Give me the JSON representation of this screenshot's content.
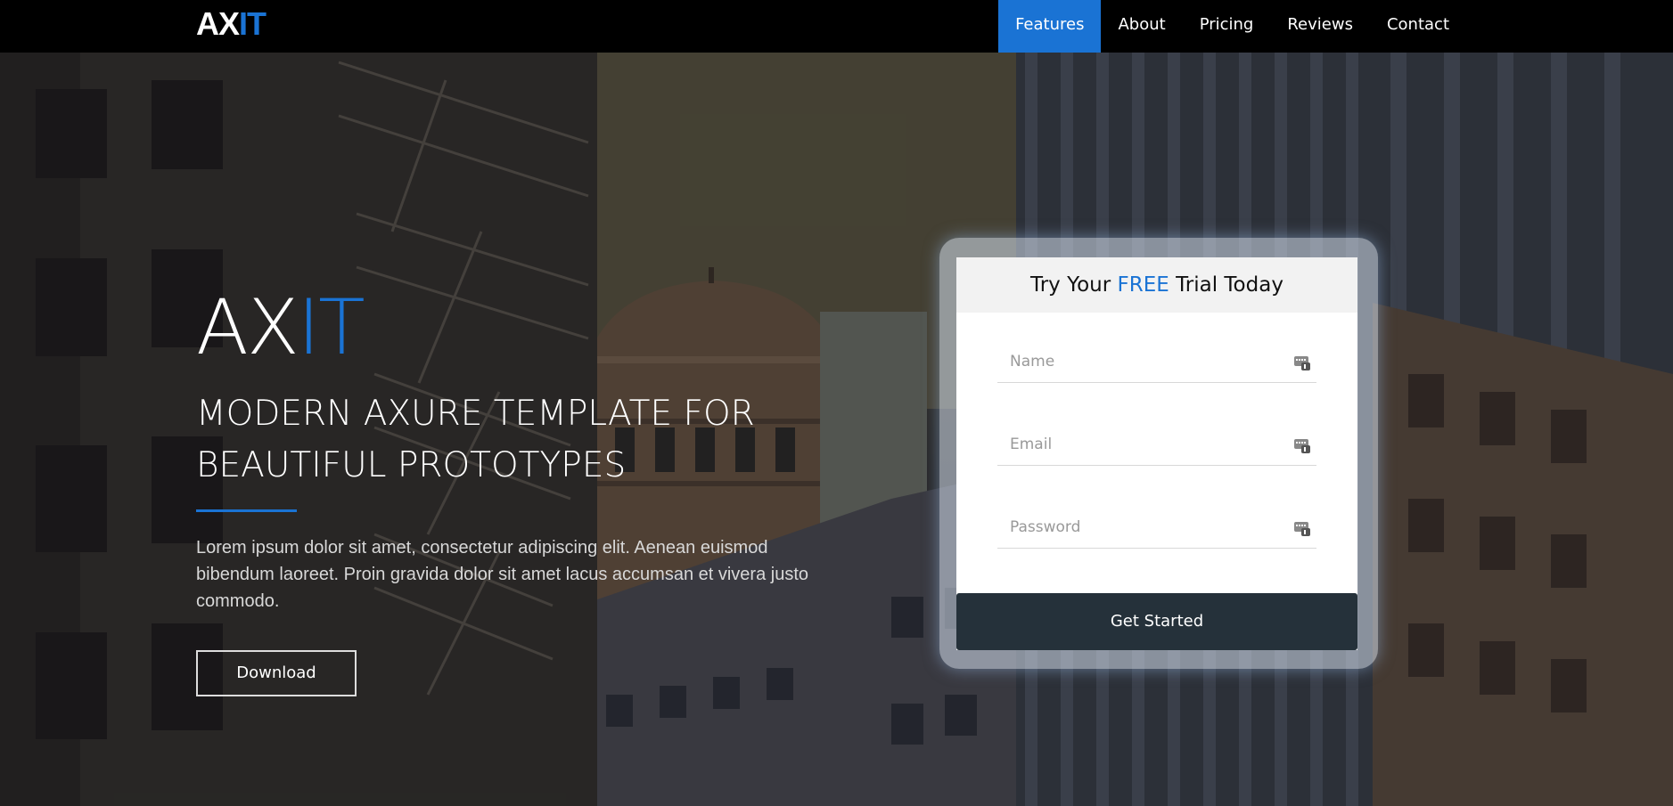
{
  "navbar": {
    "brand": {
      "main": "AX",
      "accent": "IT"
    },
    "items": [
      {
        "label": "Features",
        "active": true
      },
      {
        "label": "About",
        "active": false
      },
      {
        "label": "Pricing",
        "active": false
      },
      {
        "label": "Reviews",
        "active": false
      },
      {
        "label": "Contact",
        "active": false
      }
    ]
  },
  "hero": {
    "logo": {
      "main": "AX",
      "accent": "IT"
    },
    "title_line1": "MODERN AXURE TEMPLATE FOR",
    "title_line2": "BEAUTIFUL PROTOTYPES",
    "description": "Lorem ipsum dolor sit amet, consectetur adipiscing elit. Aenean euismod bibendum laoreet. Proin gravida dolor sit amet lacus accumsan et vivera justo commodo.",
    "download_label": "Download"
  },
  "form": {
    "title_prefix": "Try Your ",
    "title_highlight": "FREE",
    "title_suffix": " Trial Today",
    "name_placeholder": "Name",
    "email_placeholder": "Email",
    "password_placeholder": "Password",
    "submit_label": "Get Started",
    "field_icon": "autofill-key-icon"
  },
  "colors": {
    "accent": "#1a73d4",
    "navbar_bg": "#000000",
    "button_dark": "#25313a"
  }
}
